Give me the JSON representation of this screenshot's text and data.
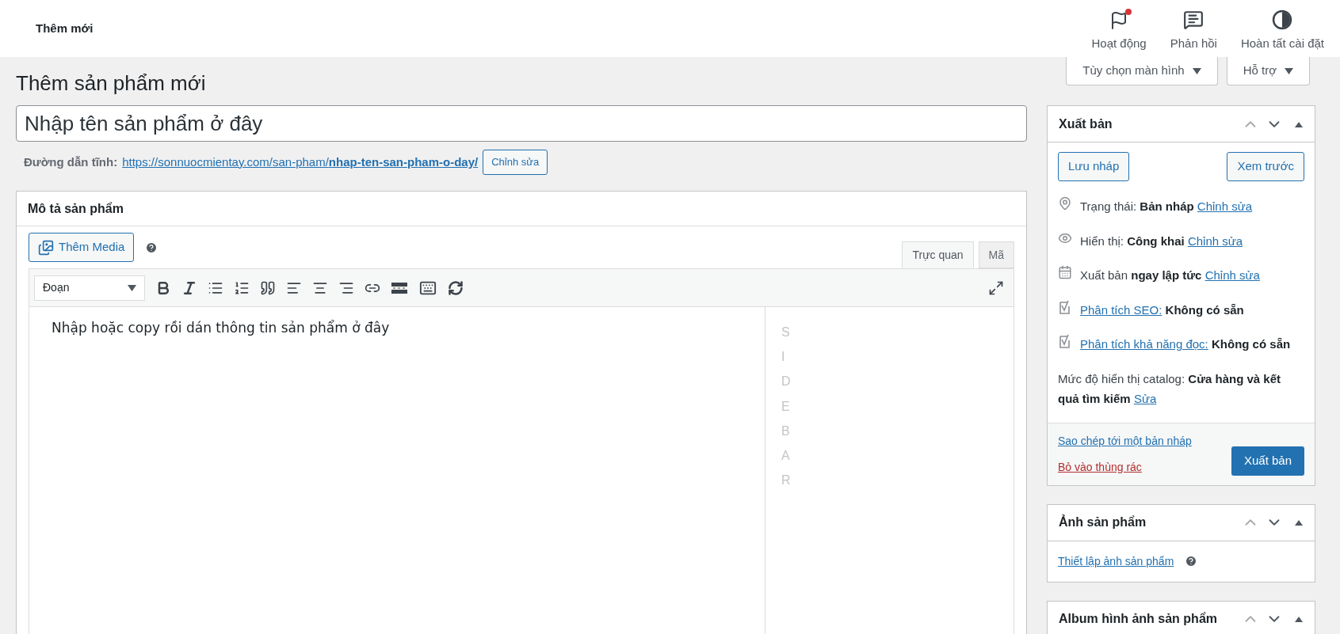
{
  "topbar": {
    "title": "Thêm mới",
    "actions": [
      {
        "kind": "flag",
        "label": "Hoạt động",
        "has_notification": true
      },
      {
        "kind": "feedback",
        "label": "Phản hồi",
        "has_notification": false
      },
      {
        "kind": "progress",
        "label": "Hoàn tất cài đặt",
        "has_notification": false
      }
    ]
  },
  "screen_tabs": [
    "Tùy chọn màn hình",
    "Hỗ trợ"
  ],
  "page_title": "Thêm sản phẩm mới",
  "title_field": {
    "placeholder": "Nhập tên sản phẩm ở đây"
  },
  "permalink": {
    "label": "Đường dẫn tĩnh:",
    "url_base": "https://sonnuocmientay.com/san-pham/",
    "slug": "nhap-ten-san-pham-o-day/",
    "button": "Chỉnh sửa"
  },
  "description": {
    "title": "Mô tả sản phẩm",
    "add_media": "Thêm Media",
    "tabs": [
      {
        "label": "Trực quan",
        "selected": true
      },
      {
        "label": "Mã",
        "selected": false
      }
    ],
    "format": "Đoạn",
    "content": "Nhập hoặc copy rồi dán thông tin sản phẩm ở đây",
    "sidebar_label": "SIDEBAR"
  },
  "publish": {
    "title": "Xuất bản",
    "save_draft": "Lưu nháp",
    "preview": "Xem trước",
    "rows": [
      {
        "kind": "pin",
        "parts": [
          {
            "kind": "text",
            "text": "Trạng thái:"
          },
          {
            "kind": "bold",
            "text": "Bản nháp"
          },
          {
            "kind": "link",
            "text": "Chỉnh sửa"
          }
        ]
      },
      {
        "kind": "eye",
        "parts": [
          {
            "kind": "text",
            "text": "Hiển thị:"
          },
          {
            "kind": "bold",
            "text": "Công khai"
          },
          {
            "kind": "link",
            "text": "Chỉnh sửa"
          }
        ]
      },
      {
        "kind": "calendar",
        "parts": [
          {
            "kind": "text",
            "text": "Xuất bản"
          },
          {
            "kind": "bold",
            "text": "ngay lập tức"
          },
          {
            "kind": "link",
            "text": "Chỉnh sửa"
          }
        ]
      },
      {
        "kind": "seo",
        "parts": [
          {
            "kind": "link",
            "text": "Phân tích SEO:"
          },
          {
            "kind": "bold",
            "text": "Không có sẵn"
          }
        ]
      },
      {
        "kind": "seo",
        "parts": [
          {
            "kind": "link",
            "text": "Phân tích khả năng đọc:"
          },
          {
            "kind": "bold",
            "text": "Không có sẵn"
          }
        ]
      },
      {
        "kind": "plain",
        "parts": [
          {
            "kind": "text",
            "text": "Mức độ hiển thị catalog:"
          },
          {
            "kind": "bold",
            "text": "Cửa hàng và kết quả tìm kiếm"
          },
          {
            "kind": "link",
            "text": "Sửa"
          }
        ]
      }
    ],
    "copy_link": "Sao chép tới một bản nháp",
    "trash_link": "Bỏ vào thùng rác",
    "publish_button": "Xuất bản"
  },
  "product_image": {
    "title": "Ảnh sản phẩm",
    "link": "Thiết lập ảnh sản phẩm"
  },
  "gallery": {
    "title": "Album hình ảnh sản phẩm"
  }
}
